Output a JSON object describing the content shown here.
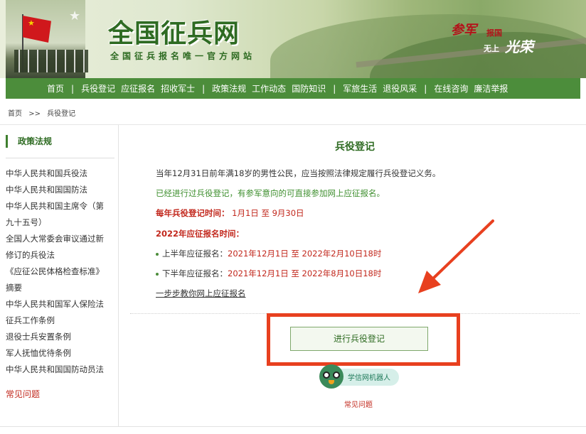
{
  "header": {
    "site_title": "全国征兵网",
    "site_subtitle": "全国征兵报名唯一官方网站",
    "slogan_part1": "参军",
    "slogan_part2": "报国",
    "slogan_part3": "无上",
    "slogan_part4": "光荣"
  },
  "nav": {
    "items": [
      "首页",
      "兵役登记",
      "应征报名",
      "招收军士",
      "政策法规",
      "工作动态",
      "国防知识",
      "军旅生活",
      "退役风采",
      "在线咨询",
      "廉洁举报"
    ],
    "separator": "|"
  },
  "breadcrumb": {
    "home": "首页",
    "sep": ">>",
    "current": "兵役登记"
  },
  "sidebar": {
    "title": "政策法规",
    "items": [
      "中华人民共和国兵役法",
      "中华人民共和国国防法",
      "中华人民共和国主席令（第",
      "九十五号）",
      "全国人大常委会审议通过新",
      "修订的兵役法",
      "《应征公民体格检查标准》",
      "摘要",
      "中华人民共和国军人保险法",
      "征兵工作条例",
      "退役士兵安置条例",
      "军人抚恤优待条例",
      "中华人民共和国国防动员法"
    ],
    "faq": "常见问题"
  },
  "main": {
    "title": "兵役登记",
    "para1": "当年12月31日前年满18岁的男性公民，应当按照法律规定履行兵役登记义务。",
    "para2": "已经进行过兵役登记，有参军意向的可直接参加网上应征报名。",
    "reg_time_label": "每年兵役登记时间：",
    "reg_time_value": "1月1日 至 9月30日",
    "year_label": "2022年应征报名时间：",
    "first_half_label": "上半年应征报名：",
    "first_half_value": "2021年12月1日 至 2022年2月10日18时",
    "second_half_label": "下半年应征报名：",
    "second_half_value": "2021年12月1日 至 2022年8月10日18时",
    "guide_link": "一步步教你网上应征报名",
    "register_button": "进行兵役登记",
    "robot_label": "学信网机器人",
    "faq_link": "常见问题"
  },
  "colors": {
    "nav_green": "#4c8d3b",
    "title_green": "#2e6b22",
    "accent_red": "#c2281d",
    "annotation_red": "#e8401f"
  }
}
